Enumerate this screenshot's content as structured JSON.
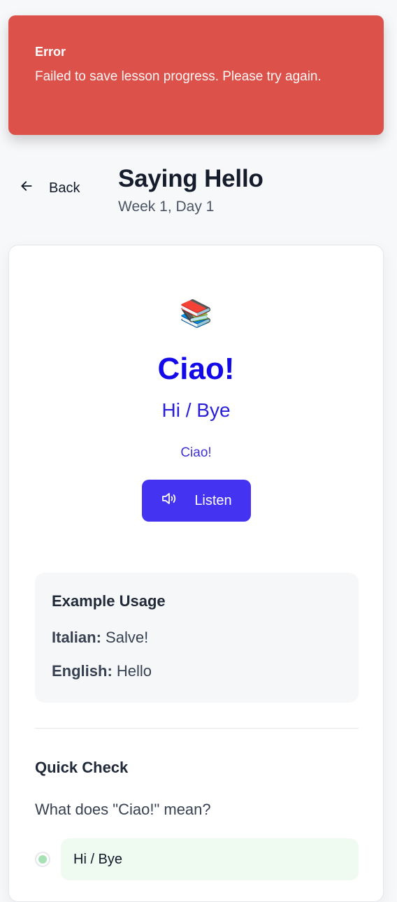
{
  "toast": {
    "title": "Error",
    "message": "Failed to save lesson progress. Please try again."
  },
  "header": {
    "back_label": "Back",
    "title": "Saying Hello",
    "subtitle": "Week 1, Day 1"
  },
  "lesson": {
    "emoji": "📚",
    "word": "Ciao!",
    "translation": "Hi / Bye",
    "pronunciation": "Ciao!",
    "listen_label": "Listen"
  },
  "example": {
    "title": "Example Usage",
    "italian_label": "Italian:",
    "italian_text": "Salve!",
    "english_label": "English:",
    "english_text": "Hello"
  },
  "quick_check": {
    "title": "Quick Check",
    "question": "What does \"Ciao!\" mean?",
    "options": [
      "Hi / Bye"
    ]
  },
  "colors": {
    "error": "#dc524b",
    "accent": "#4433f0",
    "word": "#1409e8",
    "option_bg": "#effbf1"
  }
}
